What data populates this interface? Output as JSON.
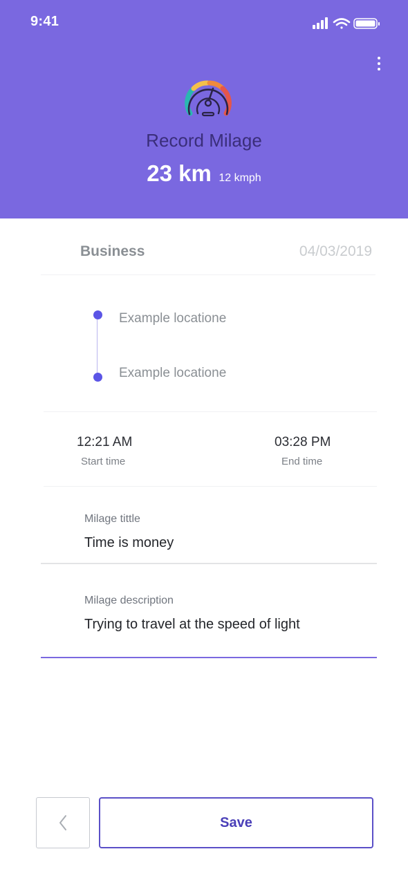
{
  "status_bar": {
    "time": "9:41"
  },
  "header": {
    "title": "Record Milage",
    "distance": "23 km",
    "speed": "12 kmph",
    "icon": "speedometer-icon",
    "color": "#7A68E0"
  },
  "trip": {
    "category": "Business",
    "date": "04/03/2019",
    "start_location": "Example locatione",
    "end_location": "Example locatione",
    "start_time": "12:21 AM",
    "start_time_label": "Start time",
    "end_time": "03:28 PM",
    "end_time_label": "End time"
  },
  "form": {
    "title_label": "Milage tittle",
    "title_value": "Time is money",
    "description_label": "Milage description",
    "description_value": "Trying to travel at the speed of light",
    "active_color": "#7A68E0"
  },
  "footer": {
    "back_icon": "chevron-left-icon",
    "save_label": "Save"
  }
}
